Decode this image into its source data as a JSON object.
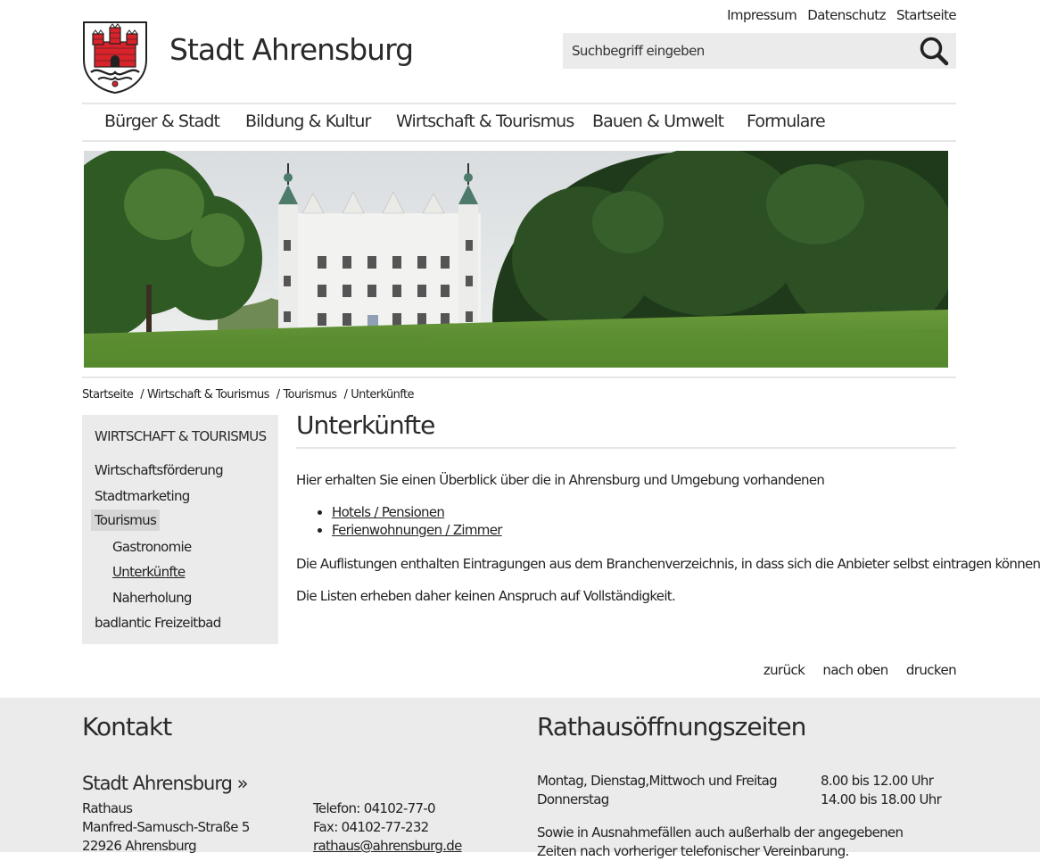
{
  "top_links": [
    "Impressum",
    "Datenschutz",
    "Startseite"
  ],
  "site_title": "Stadt Ahrensburg",
  "search": {
    "placeholder": "Suchbegriff eingeben"
  },
  "main_nav": [
    "Bürger & Stadt",
    "Bildung & Kultur",
    "Wirtschaft & Tourismus",
    "Bauen & Umwelt",
    "Formulare"
  ],
  "breadcrumb": [
    "Startseite",
    "Wirtschaft & Tourismus",
    "Tourismus",
    "Unterkünfte"
  ],
  "breadcrumb_separator": "/",
  "sidebar": {
    "heading": "Wirtschaft & Tourismus",
    "items": [
      "Wirtschaftsförderung",
      "Stadtmarketing",
      "Tourismus",
      "Gastronomie",
      "Unterkünfte",
      "Naherholung",
      "badlantic Freizeitbad"
    ]
  },
  "content": {
    "title": "Unterkünfte",
    "intro": "Hier erhalten Sie einen Überblick über die in Ahrensburg und Umgebung vorhandenen",
    "links": [
      "Hotels / Pensionen",
      "Ferienwohnungen / Zimmer"
    ],
    "para1": "Die Auflistungen enthalten Eintragungen aus dem Branchenverzeichnis, in dass sich die Anbieter selbst eintragen können.",
    "para2": "Die Listen erheben daher keinen Anspruch auf Vollständigkeit."
  },
  "page_tools": [
    "zurück",
    "nach oben",
    "drucken"
  ],
  "footer": {
    "contact_heading": "Kontakt",
    "org_name": "Stadt Ahrensburg »",
    "address": [
      "Rathaus",
      "Manfred-Samusch-Straße 5",
      "22926 Ahrensburg"
    ],
    "phone": "Telefon: 04102-77-0",
    "fax": "Fax: 04102-77-232",
    "email": "rathaus@ahrensburg.de",
    "hours_heading": "Rathausöffnungszeiten",
    "hours": [
      {
        "days": "Montag, Dienstag,Mittwoch und Freitag",
        "time": "8.00 bis 12.00 Uhr"
      },
      {
        "days": "Donnerstag",
        "time": "14.00 bis 18.00 Uhr"
      }
    ],
    "hours_note": "Sowie in Ausnahmefällen auch außerhalb der angegebenen Zeiten nach vorheriger telefonischer Vereinbarung."
  },
  "colors": {
    "panel_gray": "#ebebeb",
    "rule_gray": "#e6e6e6",
    "emblem_red": "#d8232a",
    "text": "#222222"
  },
  "icons": {
    "logo": "city-coat-of-arms",
    "search": "magnifier-icon"
  }
}
